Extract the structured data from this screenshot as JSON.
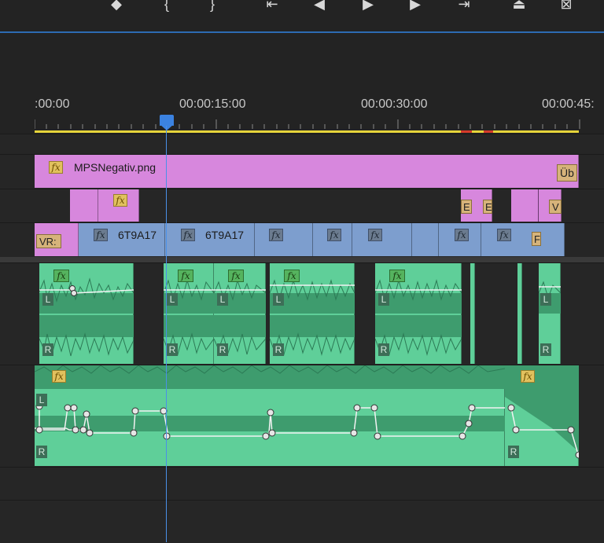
{
  "toolbar": {
    "buttons": [
      {
        "name": "add-marker-icon",
        "glyph": "◆"
      },
      {
        "name": "mark-in-icon",
        "glyph": "{"
      },
      {
        "name": "mark-out-icon",
        "glyph": "}"
      },
      {
        "name": "go-to-in-icon",
        "glyph": "⇤"
      },
      {
        "name": "step-back-icon",
        "glyph": "◀"
      },
      {
        "name": "play-icon",
        "glyph": "▶"
      },
      {
        "name": "step-forward-icon",
        "glyph": "▶"
      },
      {
        "name": "go-to-out-icon",
        "glyph": "⇥"
      },
      {
        "name": "lift-icon",
        "glyph": "⏏"
      },
      {
        "name": "extract-icon",
        "glyph": "⊠"
      }
    ]
  },
  "ruler": {
    "timecodes": [
      ":00:00",
      "00:00:15:00",
      "00:00:30:00",
      "00:00:45:"
    ]
  },
  "tracks": {
    "v3": {
      "clip_name": "MPSNegativ.png",
      "fx_label": "fx",
      "end_badge": "Üb"
    },
    "v2": {
      "fx_label": "fx",
      "badges": [
        "E",
        "E",
        "V"
      ]
    },
    "v1": {
      "left_badge": "VR:",
      "clip_a": "6T9A17",
      "clip_b": "6T9A17",
      "fx_label": "fx",
      "end_badge": "F"
    },
    "a1": {
      "fx_label": "fx",
      "left_channel": "L",
      "right_channel": "R"
    },
    "a2": {
      "fx_label": "fx",
      "left_channel": "L",
      "right_channel": "R"
    }
  },
  "colors": {
    "accent_blue": "#3b82e0",
    "work_area": "#e6d43a",
    "render_red": "#d63a2a",
    "graphics_clip": "#d787dd",
    "video_clip": "#7d9ece",
    "audio_clip": "#5fcf99"
  }
}
